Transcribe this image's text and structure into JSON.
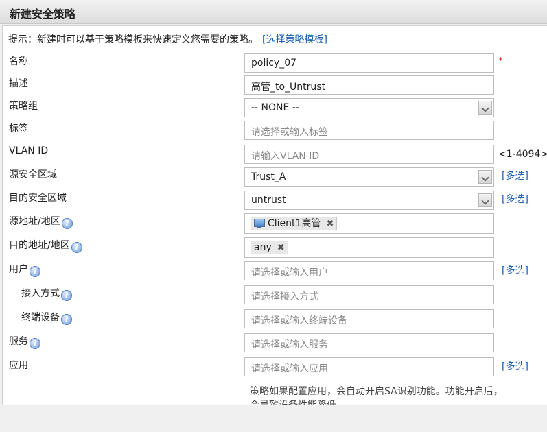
{
  "window": {
    "title": "新建安全策略"
  },
  "hint": {
    "text": "提示：新建时可以基于策略模板来快速定义您需要的策略。",
    "link": "[选择策略模板]"
  },
  "fields": {
    "name": {
      "label": "名称",
      "value": "policy_07",
      "required_mark": "*"
    },
    "description": {
      "label": "描述",
      "value": "高管_to_Untrust"
    },
    "policy_group": {
      "label": "策略组",
      "value": "-- NONE --"
    },
    "tag": {
      "label": "标签",
      "placeholder": "请选择或输入标签"
    },
    "vlan_id": {
      "label": "VLAN ID",
      "placeholder": "请输入VLAN ID",
      "range": "<1-4094>"
    },
    "source_zone": {
      "label": "源安全区域",
      "value": "Trust_A",
      "multi": "[多选]"
    },
    "dest_zone": {
      "label": "目的安全区域",
      "value": "untrust",
      "multi": "[多选]"
    },
    "source_addr": {
      "label": "源地址/地区",
      "tag": "Client1高管"
    },
    "dest_addr": {
      "label": "目的地址/地区",
      "tag": "any"
    },
    "user": {
      "label": "用户",
      "placeholder": "请选择或输入用户",
      "multi": "[多选]"
    },
    "access_mode": {
      "label": "接入方式",
      "placeholder": "请选择接入方式"
    },
    "terminal": {
      "label": "终端设备",
      "placeholder": "请选择或输入终端设备"
    },
    "service": {
      "label": "服务",
      "placeholder": "请选择或输入服务"
    },
    "application": {
      "label": "应用",
      "placeholder": "请选择或输入应用",
      "multi": "[多选]"
    }
  },
  "note": {
    "text": "策略如果配置应用，会自动开启SA识别功能。功能开启后，会导致设备性能降低。"
  },
  "help_glyph": "?",
  "remove_glyph": "✖",
  "icons": {
    "help": "question-circle-icon",
    "remove": "close-icon",
    "source_tag": "computer-monitor-icon",
    "dropdown": "chevron-down-icon"
  }
}
